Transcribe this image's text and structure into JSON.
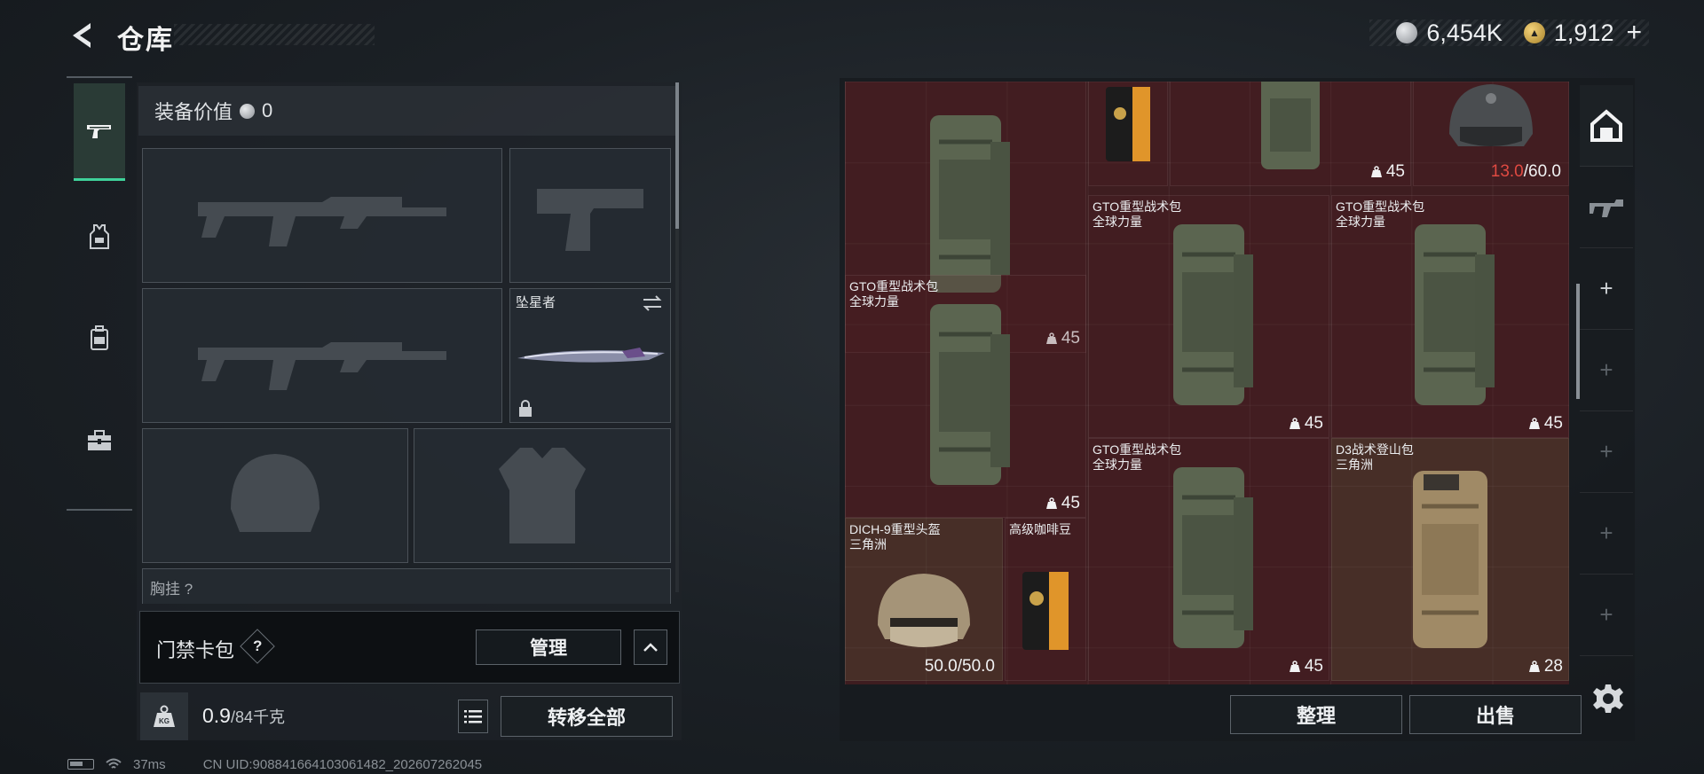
{
  "header": {
    "title": "仓库",
    "currency_silver": "6,454K",
    "currency_gold": "1,912",
    "add_label": "+"
  },
  "categories": [
    {
      "name": "weapons-tab",
      "icon": "pistol-icon",
      "active": true
    },
    {
      "name": "armor-tab",
      "icon": "vest-icon",
      "active": false
    },
    {
      "name": "backpack-tab",
      "icon": "backpack-icon",
      "active": false
    },
    {
      "name": "toolbox-tab",
      "icon": "toolbox-icon",
      "active": false
    }
  ],
  "loadout": {
    "equip_value_label": "装备价值",
    "equip_value": "0",
    "melee_name": "坠星者",
    "chest_label": "胸挂 ?",
    "access_label": "门禁卡包",
    "help_label": "?",
    "manage_label": "管理",
    "weight_current": "0.9",
    "weight_cap": "/84千克",
    "transfer_all_label": "转移全部",
    "kg_label": "KG"
  },
  "stash": {
    "items": [
      {
        "name": "",
        "sub": "",
        "qty": "45",
        "type": "pack"
      },
      {
        "name": "",
        "sub": "",
        "qty": "",
        "type": "coffee"
      },
      {
        "name": "",
        "sub": "",
        "qty": "45",
        "type": "pack"
      },
      {
        "name": "",
        "sub": "",
        "dur_low": "13.0",
        "dur_max": "/60.0",
        "type": "helmet-dark"
      },
      {
        "name": "GTO重型战术包",
        "sub": "全球力量",
        "qty": "45",
        "type": "pack"
      },
      {
        "name": "GTO重型战术包",
        "sub": "全球力量",
        "qty": "45",
        "type": "pack"
      },
      {
        "name": "GTO重型战术包",
        "sub": "全球力量",
        "qty": "45",
        "type": "pack"
      },
      {
        "name": "GTO重型战术包",
        "sub": "全球力量",
        "qty": "45",
        "type": "pack"
      },
      {
        "name": "D3战术登山包",
        "sub": "三角洲",
        "qty": "28",
        "type": "tan-pack"
      },
      {
        "name": "DICH-9重型头盔",
        "sub": "三角洲",
        "durability": "50.0/50.0",
        "type": "helmet-tan"
      },
      {
        "name": "高级咖啡豆",
        "sub": "",
        "qty": "",
        "type": "coffee"
      }
    ],
    "sort_label": "整理",
    "sell_label": "出售"
  },
  "side": {
    "plus": "+"
  },
  "status": {
    "ping": "37ms",
    "uid": "CN UID:9088416641030614​82_202607262045"
  },
  "colors": {
    "accent": "#3fd29a",
    "stash_bg": "#3e1d20",
    "low_durability": "#e04a42"
  }
}
